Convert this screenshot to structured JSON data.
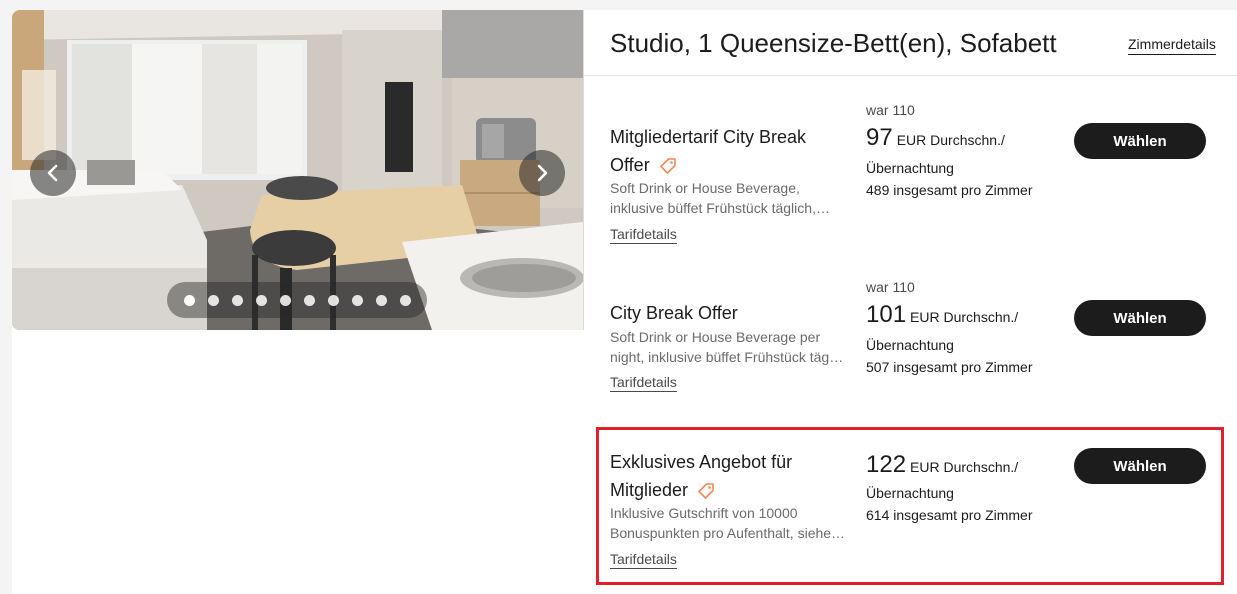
{
  "gallery": {
    "prev_icon": "chevron-left-icon",
    "next_icon": "chevron-right-icon",
    "dot_count": 10,
    "active_index": 0
  },
  "room": {
    "title": "Studio, 1 Queensize-Bett(en), Sofabett",
    "details_link": "Zimmerdetails"
  },
  "rates": [
    {
      "name_line1": "Mitgliedertarif City Break",
      "name_line2": "Offer",
      "has_tag": true,
      "desc_line1": "Soft Drink or House Beverage,",
      "desc_line2": "inklusive büffet Frühstück täglich,…",
      "details_link": "Tarifdetails",
      "was": "war 110",
      "price": "97",
      "unit": "EUR Durchschn./",
      "per_night": "Übernachtung",
      "total": "489 insgesamt pro Zimmer",
      "button": "Wählen"
    },
    {
      "name_line1": "City Break Offer",
      "name_line2": "",
      "has_tag": false,
      "desc_line1": "Soft Drink or House Beverage per",
      "desc_line2": "night, inklusive büffet Frühstück tägli…",
      "details_link": "Tarifdetails",
      "was": "war 110",
      "price": "101",
      "unit": "EUR Durchschn./",
      "per_night": "Übernachtung",
      "total": "507 insgesamt pro Zimmer",
      "button": "Wählen"
    },
    {
      "name_line1": "Exklusives Angebot für",
      "name_line2": "Mitglieder",
      "has_tag": true,
      "desc_line1": "Inklusive Gutschrift von 10000",
      "desc_line2": "Bonuspunkten pro Aufenthalt, siehe…",
      "details_link": "Tarifdetails",
      "was": "",
      "price": "122",
      "unit": "EUR Durchschn./",
      "per_night": "Übernachtung",
      "total": "614 insgesamt pro Zimmer",
      "button": "Wählen"
    }
  ],
  "colors": {
    "button_bg": "#1c1c1c",
    "tag_accent": "#f0895a",
    "highlight_border": "#e0212c"
  }
}
